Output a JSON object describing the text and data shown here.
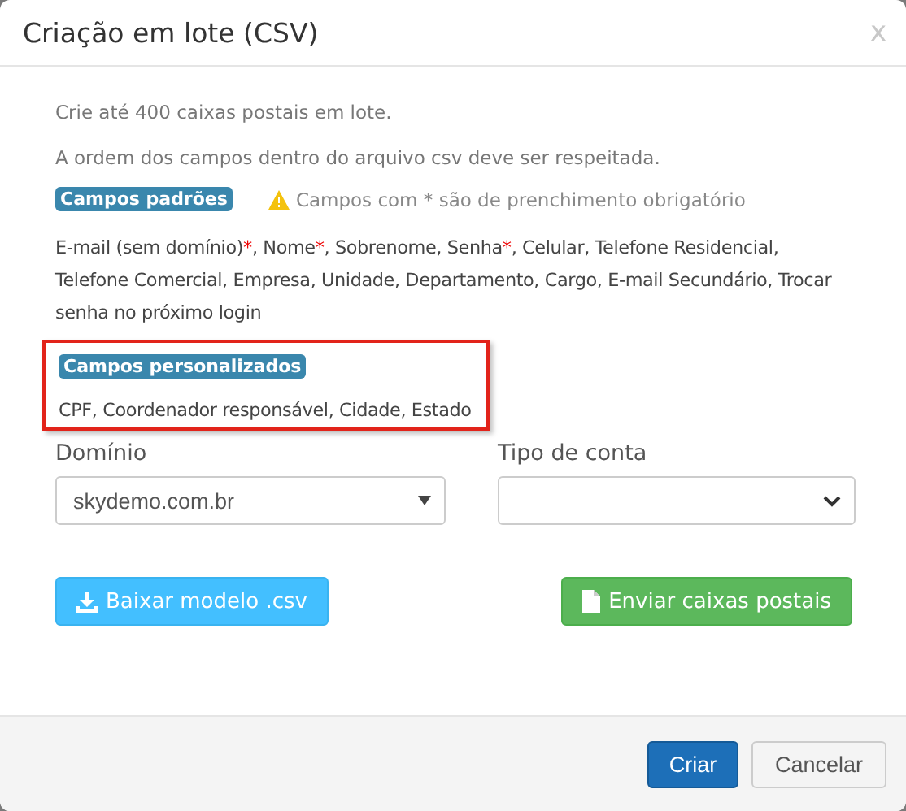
{
  "dialog": {
    "title": "Criação em lote (CSV)",
    "close": "x"
  },
  "intro": [
    "Crie até 400 caixas postais em lote.",
    "A ordem dos campos dentro do arquivo csv deve ser respeitada."
  ],
  "standard_fields": {
    "badge": "Campos padrões",
    "warning": "Campos com * são de prenchimento obrigatório",
    "segments": [
      {
        "kind": "plain",
        "text": "E-mail (sem domínio)"
      },
      {
        "kind": "required",
        "text": "*"
      },
      {
        "kind": "plain",
        "text": ", Nome"
      },
      {
        "kind": "required",
        "text": "*"
      },
      {
        "kind": "plain",
        "text": ", Sobrenome, Senha"
      },
      {
        "kind": "required",
        "text": "*"
      },
      {
        "kind": "plain",
        "text": ", Celular, Telefone Residencial, Telefone Comercial, Empresa, Unidade, Departamento, Cargo, E-mail Secundário, Trocar senha no próximo login"
      }
    ]
  },
  "custom_fields": {
    "badge": "Campos personalizados",
    "text": "CPF, Coordenador responsável, Cidade, Estado",
    "highlighted": true
  },
  "fields": [
    {
      "label": "Domínio",
      "value": "skydemo.com.br",
      "kind": "plain"
    },
    {
      "label": "Tipo de conta",
      "kind": "native"
    }
  ],
  "actions": [
    {
      "label": "Baixar modelo .csv",
      "kind": "download"
    },
    {
      "label": "Enviar caixas postais",
      "kind": "upload"
    }
  ],
  "footer_buttons": [
    {
      "label": "Criar",
      "kind": "primary"
    },
    {
      "label": "Cancelar",
      "kind": "default"
    }
  ]
}
